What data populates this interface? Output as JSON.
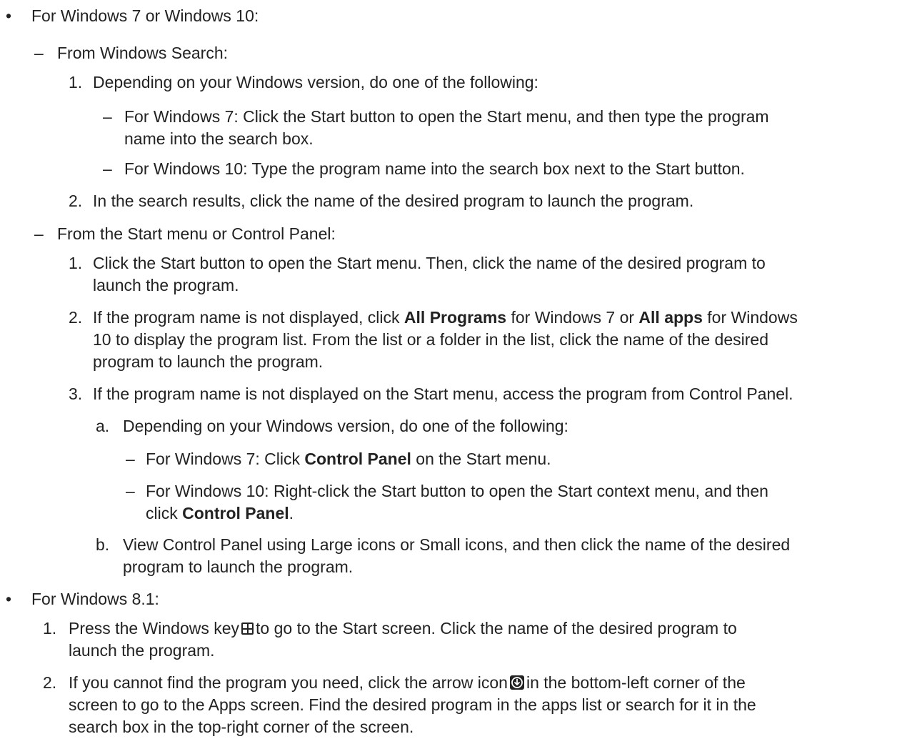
{
  "markers": {
    "bullet": "•",
    "dash": "–",
    "n1": "1.",
    "n2": "2.",
    "n3": "3.",
    "a": "a.",
    "b": "b."
  },
  "section_win7_10": {
    "heading": "For Windows 7 or Windows 10:",
    "search": {
      "heading": "From Windows Search:",
      "step1": "Depending on your Windows version, do one of the following:",
      "step1_win7_line1": "For Windows 7: Click the Start button to open the Start menu, and then type the program",
      "step1_win7_line2": "name into the search box.",
      "step1_win10": "For Windows 10: Type the program name into the search box next to the Start button.",
      "step2": "In the search results, click the name of the desired program to launch the program."
    },
    "start_menu": {
      "heading": "From the Start menu or Control Panel:",
      "step1_line1": "Click the Start button to open the Start menu. Then, click the name of the desired program to",
      "step1_line2": "launch the program.",
      "step2_line1_a": "If the program name is not displayed, click ",
      "step2_line1_b": "All Programs",
      "step2_line1_c": " for Windows 7 or ",
      "step2_line1_d": "All apps",
      "step2_line1_e": " for Windows",
      "step2_line2": "10 to display the program list. From the list or a folder in the list, click the name of the desired",
      "step2_line3": "program to launch the program.",
      "step3": "If the program name is not displayed on the Start menu, access the program from Control Panel.",
      "step3a": "Depending on your Windows version, do one of the following:",
      "step3a_win7_a": "For Windows 7: Click ",
      "step3a_win7_b": "Control Panel",
      "step3a_win7_c": " on the Start menu.",
      "step3a_win10_line1": "For Windows 10: Right-click the Start button to open the Start context menu, and then",
      "step3a_win10_line2_a": "click ",
      "step3a_win10_line2_b": "Control Panel",
      "step3a_win10_line2_c": ".",
      "step3b_line1": "View Control Panel using Large icons or Small icons, and then click the name of the desired",
      "step3b_line2": "program to launch the program."
    }
  },
  "section_win81": {
    "heading": "For Windows 8.1:",
    "step1_line1_a": "Press the Windows key",
    "step1_line1_b": "to go to the Start screen. Click the name of the desired program to",
    "step1_line2": "launch the program.",
    "step2_line1_a": "If you cannot find the program you need, click the arrow icon",
    "step2_line1_b": "in the bottom-left corner of the",
    "step2_line2": "screen to go to the Apps screen. Find the desired program in the apps list or search for it in the",
    "step2_line3": "search box in the top-right corner of the screen."
  },
  "icons": {
    "windows_key": "windows-key-icon",
    "arrow": "arrow-down-circle-icon"
  }
}
